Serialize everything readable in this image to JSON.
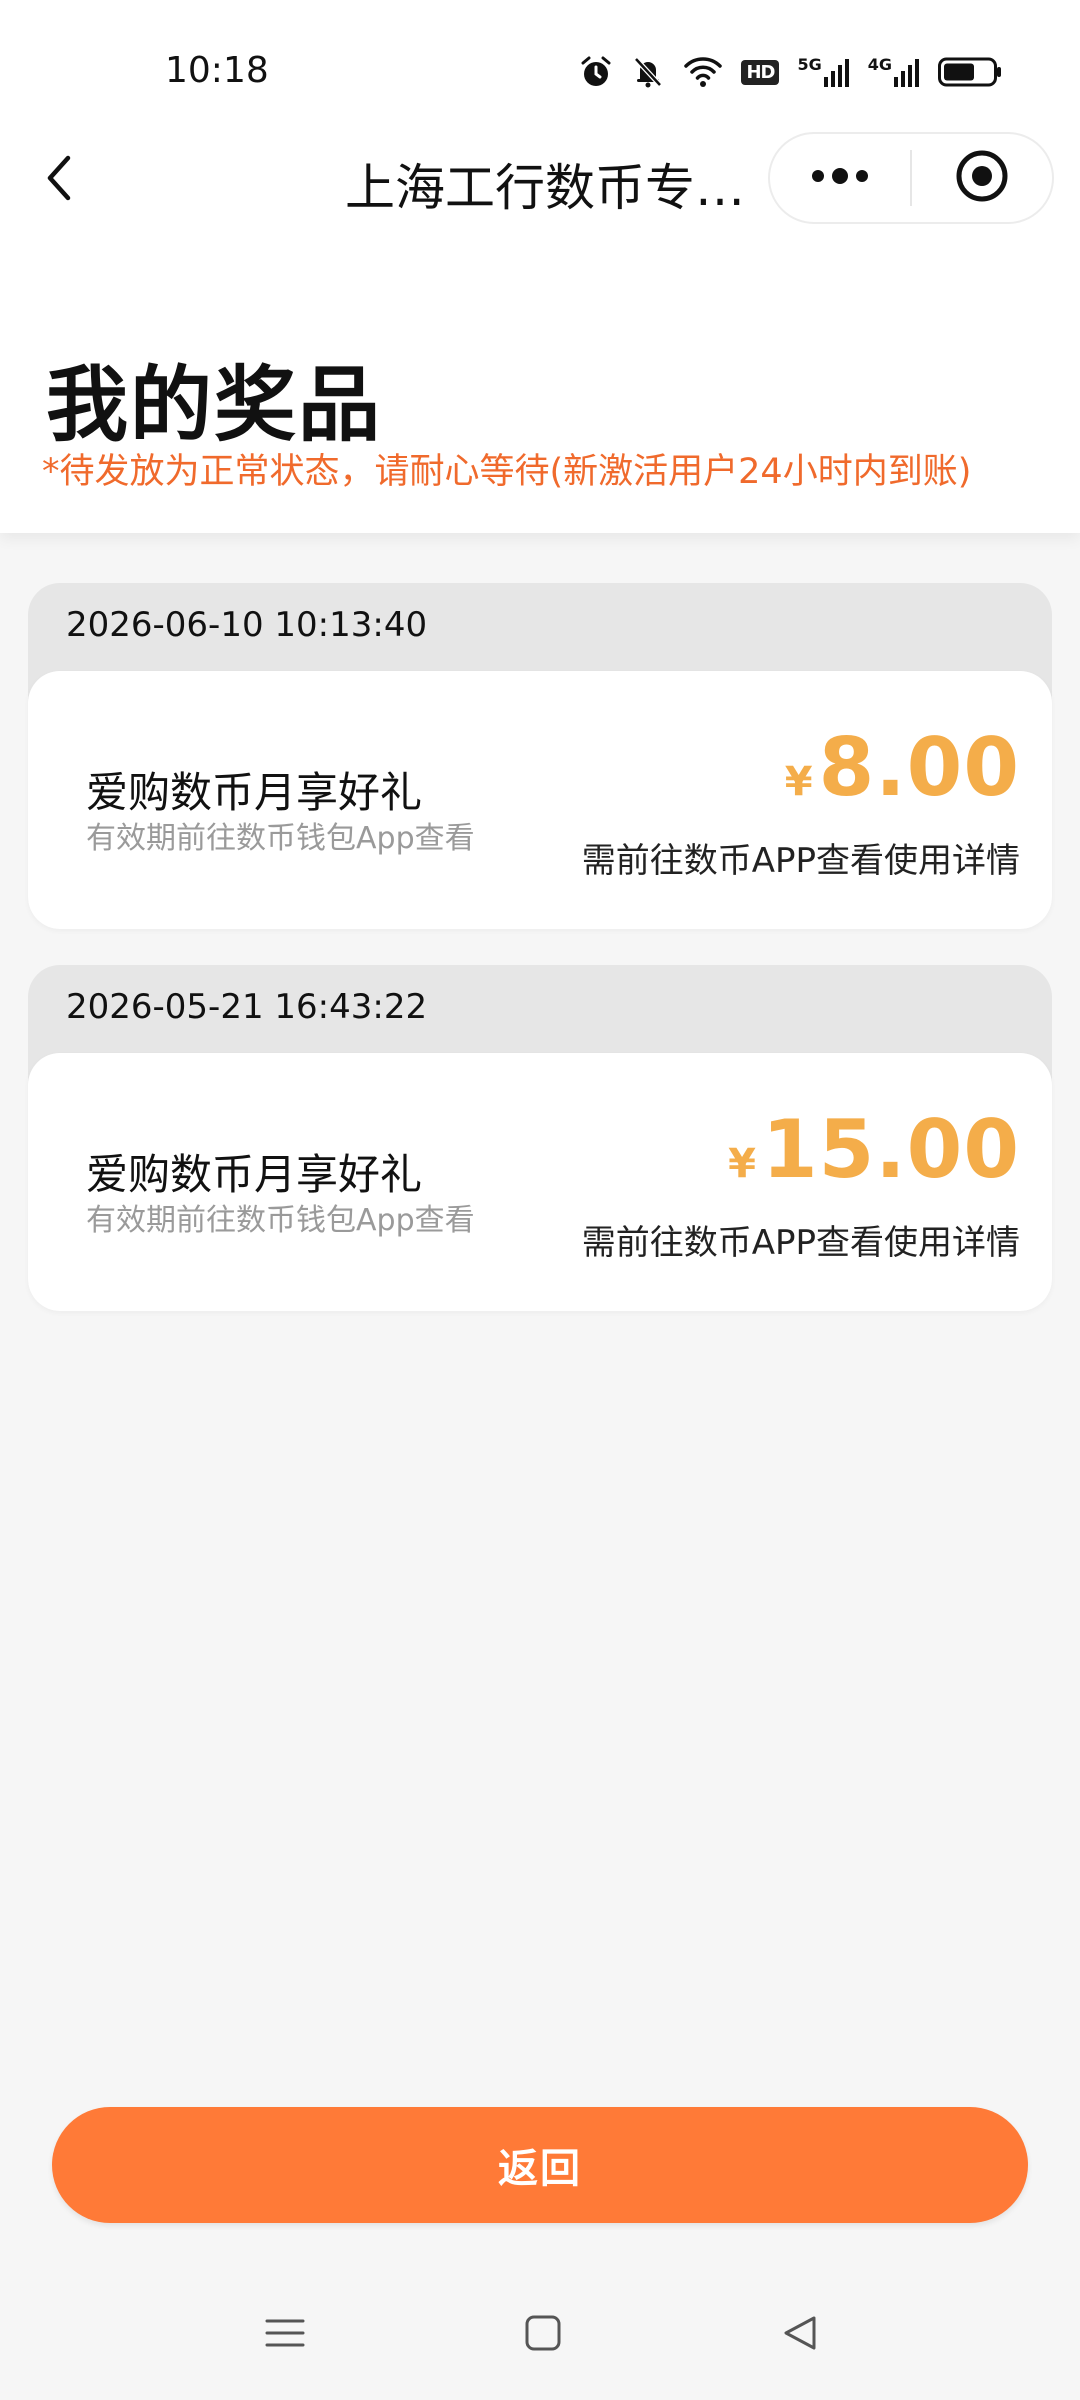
{
  "status_bar": {
    "time": "10:18",
    "hd_label": "HD",
    "net1_label": "5G",
    "net2_label": "4G",
    "icons": [
      "alarm-icon",
      "mute-icon",
      "wifi-icon",
      "hd-icon",
      "signal-5g-icon",
      "signal-4g-icon",
      "battery-icon"
    ]
  },
  "nav": {
    "title": "上海工行数币专…",
    "back_icon": "chevron-left-icon",
    "more_icon": "more-dots-icon",
    "close_icon": "target-close-icon"
  },
  "page": {
    "title": "我的奖品",
    "notice": "*待发放为正常状态，请耐心等待(新激活用户24小时内到账)"
  },
  "prizes": [
    {
      "date": "2026-06-10 10:13:40",
      "name": "爱购数币月享好礼",
      "subtitle": "有效期前往数币钱包App查看",
      "currency": "¥",
      "amount": "8.00",
      "hint": "需前往数币APP查看使用详情"
    },
    {
      "date": "2026-05-21 16:43:22",
      "name": "爱购数币月享好礼",
      "subtitle": "有效期前往数币钱包App查看",
      "currency": "¥",
      "amount": "15.00",
      "hint": "需前往数币APP查看使用详情"
    }
  ],
  "actions": {
    "return_label": "返回"
  },
  "system_nav": {
    "icons": [
      "menu-icon",
      "home-square-icon",
      "back-triangle-icon"
    ]
  },
  "colors": {
    "accent": "#ff7a37",
    "amount": "#f4ad4a",
    "notice": "#f06a2c"
  }
}
